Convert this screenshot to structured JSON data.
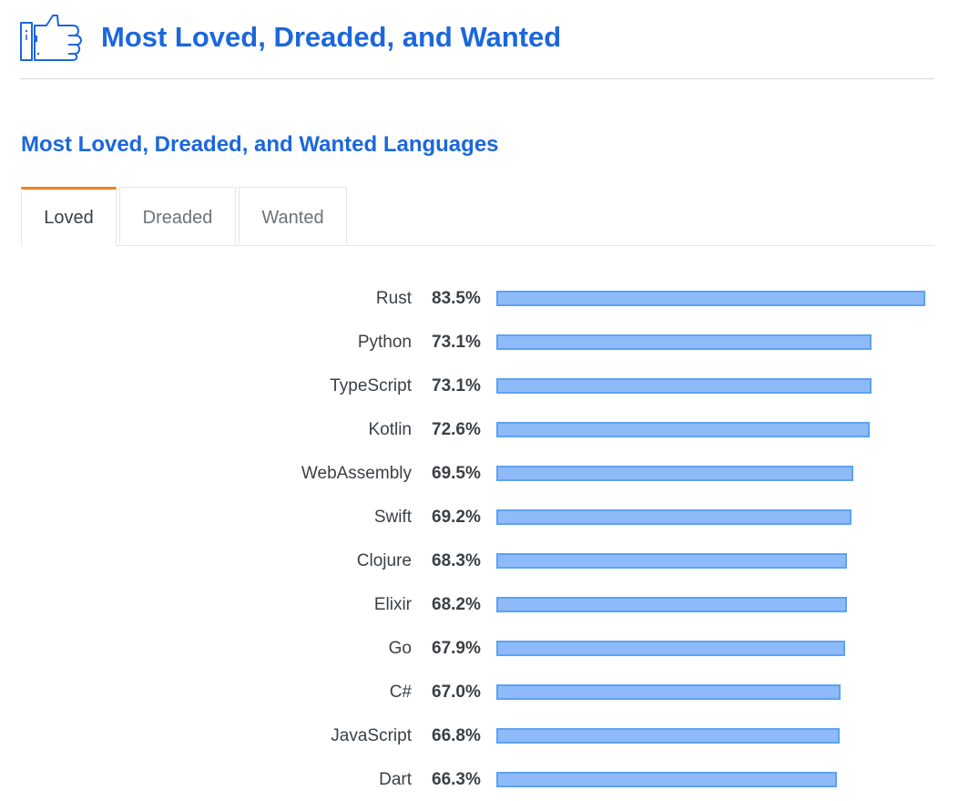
{
  "header": {
    "title": "Most Loved, Dreaded, and Wanted",
    "icon": "thumbs-up-icon",
    "accent_color": "#1b67dd"
  },
  "section": {
    "title": "Most Loved, Dreaded, and Wanted Languages"
  },
  "tabs": [
    {
      "label": "Loved",
      "active": true
    },
    {
      "label": "Dreaded",
      "active": false
    },
    {
      "label": "Wanted",
      "active": false
    }
  ],
  "chart_data": {
    "type": "bar",
    "orientation": "horizontal",
    "unit": "%",
    "bar_color": "#8fbaf9",
    "bar_border_color": "#5da2f5",
    "categories": [
      "Rust",
      "Python",
      "TypeScript",
      "Kotlin",
      "WebAssembly",
      "Swift",
      "Clojure",
      "Elixir",
      "Go",
      "C#",
      "JavaScript",
      "Dart"
    ],
    "values": [
      83.5,
      73.1,
      73.1,
      72.6,
      69.5,
      69.2,
      68.3,
      68.2,
      67.9,
      67.0,
      66.8,
      66.3
    ],
    "value_labels": [
      "83.5%",
      "73.1%",
      "73.1%",
      "72.6%",
      "69.5%",
      "69.2%",
      "68.3%",
      "68.2%",
      "67.9%",
      "67.0%",
      "66.8%",
      "66.3%"
    ]
  }
}
